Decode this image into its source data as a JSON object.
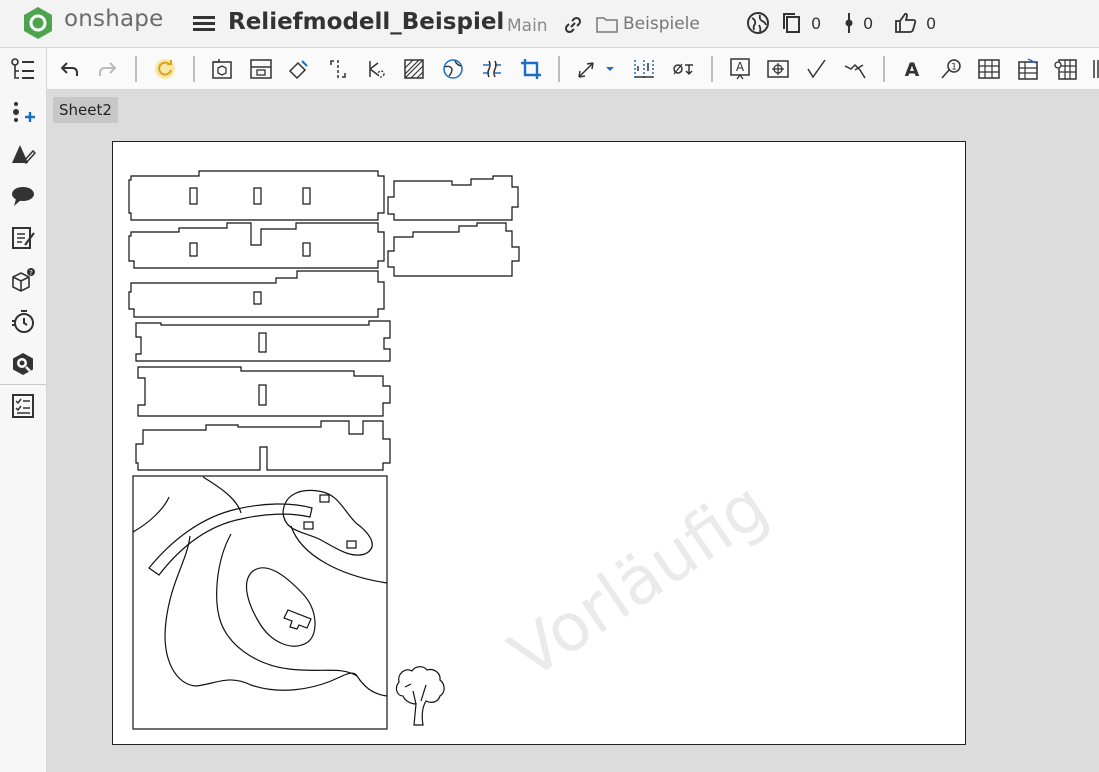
{
  "app": {
    "brand": "onshape"
  },
  "document": {
    "title": "Reliefmodell_Beispiel",
    "branch": "Main",
    "folder": "Beispiele",
    "stats": {
      "versions": "0",
      "branches": "0",
      "likes": "0"
    }
  },
  "sheet": {
    "tab_label": "Sheet2",
    "watermark": "Vorläufig"
  },
  "icons": {
    "sidebar": [
      "feature-list-icon",
      "insert-icon",
      "appearance-icon",
      "comments-icon",
      "notes-icon",
      "parts-icon",
      "history-icon",
      "search-icon",
      "checklist-icon"
    ]
  },
  "colors": {
    "logo_green": "#4ca54d",
    "accent_blue": "#1a6fc4",
    "rebuild_yellow": "#f2c94c"
  }
}
